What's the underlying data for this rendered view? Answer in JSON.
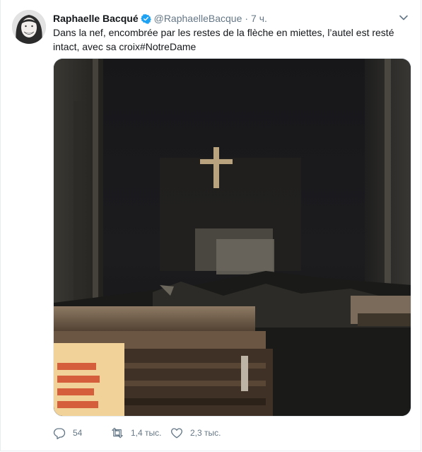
{
  "tweet": {
    "author_name": "Raphaelle Bacqué",
    "author_handle": "@RaphaelleBacque",
    "separator": "·",
    "time": "7 ч.",
    "text": "Dans la nef, encombrée par les restes de la flèche en miettes, l’autel est resté intact, avec sa croix#NotreDame",
    "icons": {
      "verified": "verified-badge-icon",
      "menu": "chevron-down-icon",
      "reply": "reply-icon",
      "retweet": "retweet-icon",
      "like": "heart-icon"
    },
    "stats": {
      "replies": "54",
      "retweets": "1,4 тыс.",
      "likes": "2,3 тыс."
    }
  },
  "colors": {
    "verified": "#1da1f2",
    "text_secondary": "#657786",
    "border": "#e6ecf0"
  }
}
